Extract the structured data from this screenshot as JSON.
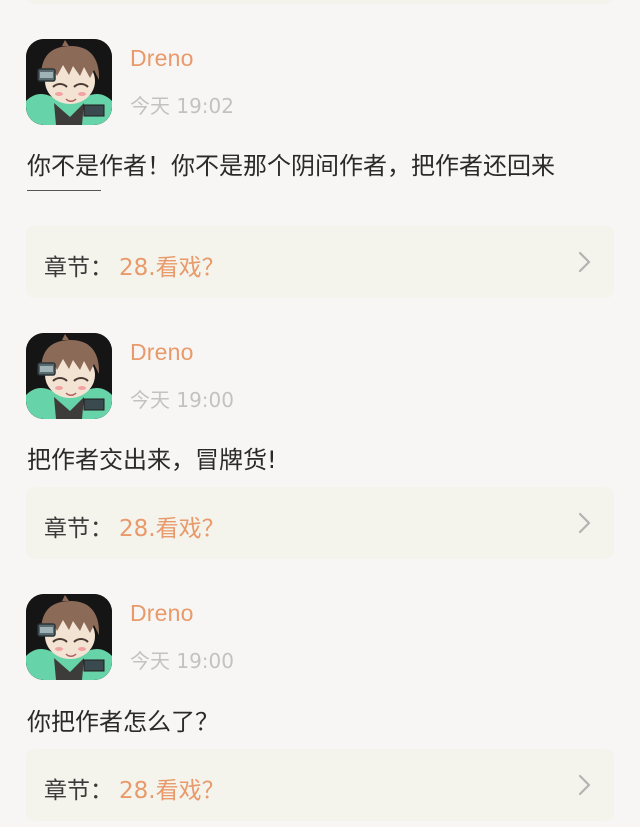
{
  "comments": [
    {
      "username": "Dreno",
      "timestamp": "今天 19:02",
      "text": "你不是作者！你不是那个阴间作者，把作者还回来",
      "chapter_prefix": "章节：",
      "chapter_title": "28.看戏？"
    },
    {
      "username": "Dreno",
      "timestamp": "今天 19:00",
      "text": "把作者交出来，冒牌货!",
      "chapter_prefix": "章节：",
      "chapter_title": "28.看戏？"
    },
    {
      "username": "Dreno",
      "timestamp": "今天 19:00",
      "text": "你把作者怎么了？",
      "chapter_prefix": "章节：",
      "chapter_title": "28.看戏？"
    }
  ],
  "icons": {
    "avatar": "anime-avatar-icon",
    "chapter_chevron": "chevron-right-icon"
  },
  "colors": {
    "background": "#f8f6f5",
    "accent": "#e89a6a",
    "timestamp": "#c2c2c2",
    "card": "#f4f3ec",
    "text": "#2a2a2a"
  }
}
